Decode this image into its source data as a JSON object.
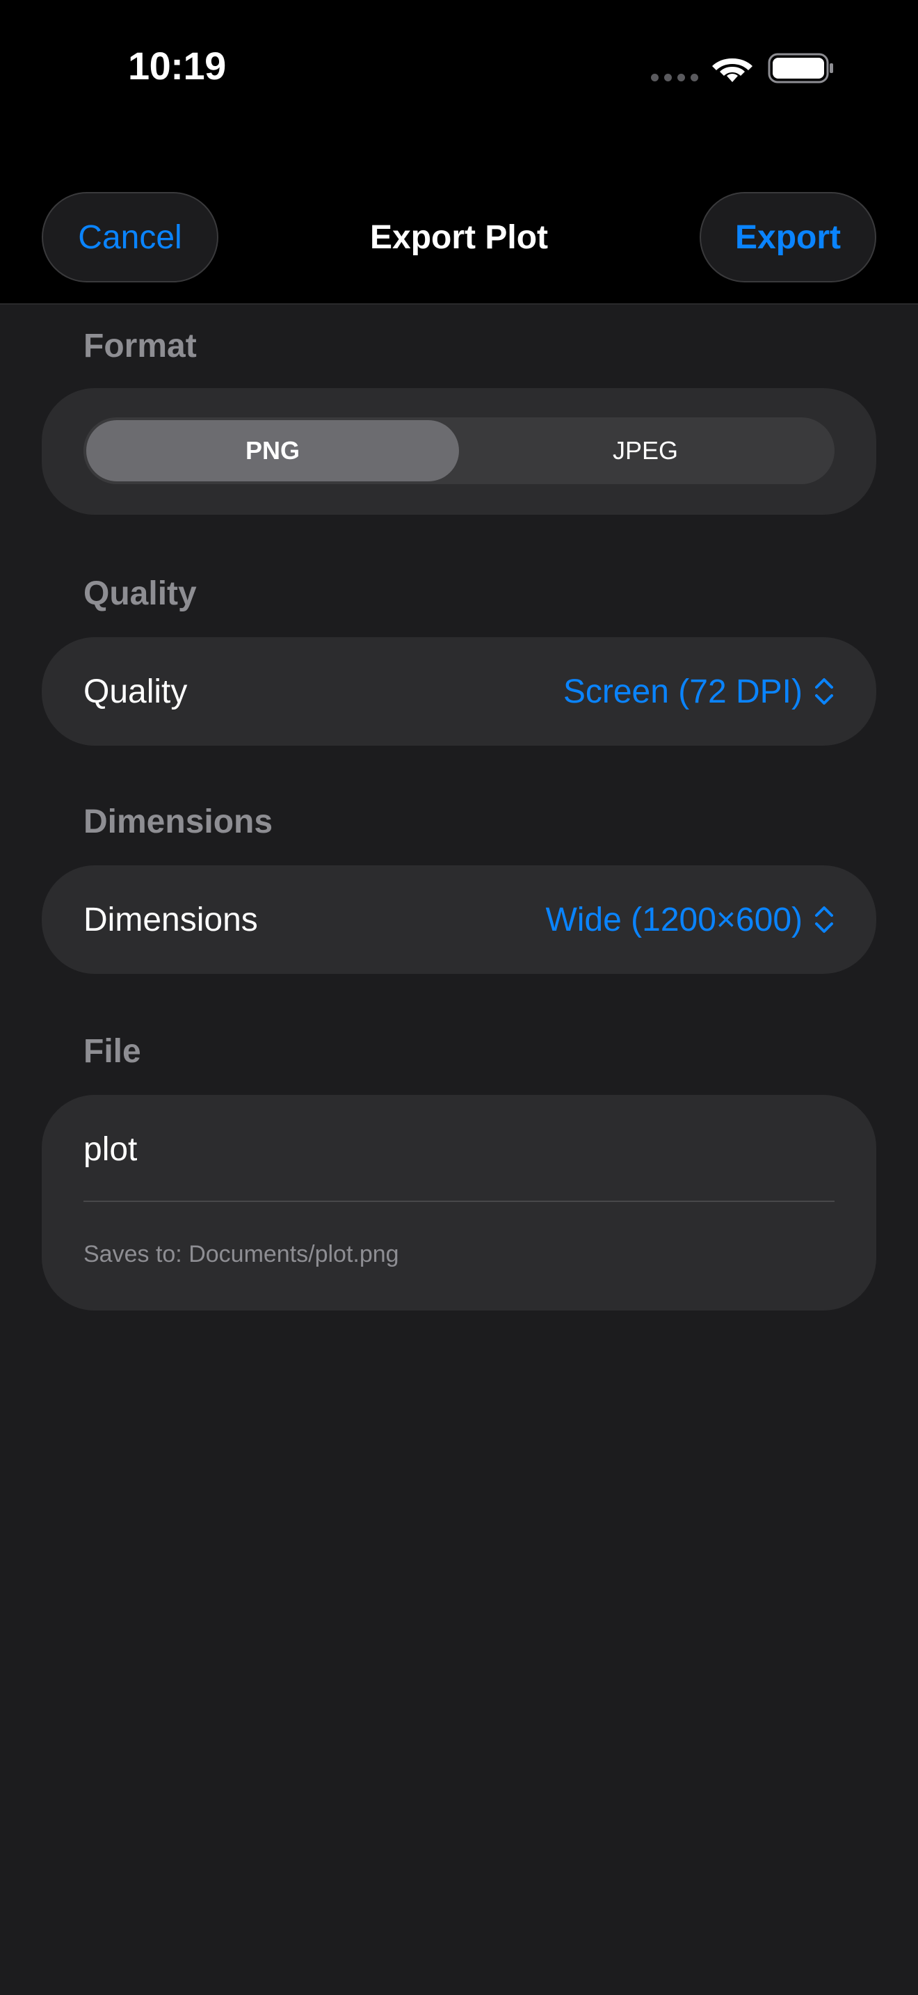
{
  "status_bar": {
    "time": "10:19",
    "wifi_icon": "wifi-icon",
    "battery_icon": "battery-icon"
  },
  "nav": {
    "cancel_label": "Cancel",
    "title": "Export Plot",
    "export_label": "Export"
  },
  "sections": {
    "format": {
      "header": "Format",
      "options": [
        "PNG",
        "JPEG"
      ],
      "selected": "PNG"
    },
    "quality": {
      "header": "Quality",
      "label": "Quality",
      "value": "Screen (72 DPI)"
    },
    "dimensions": {
      "header": "Dimensions",
      "label": "Dimensions",
      "value": "Wide (1200×600)"
    },
    "file": {
      "header": "File",
      "filename": "plot",
      "save_path": "Saves to: Documents/plot.png"
    }
  },
  "colors": {
    "accent": "#0a84ff",
    "background": "#1c1c1e",
    "card": "#2c2c2e",
    "secondary_text": "#8e8e93"
  }
}
